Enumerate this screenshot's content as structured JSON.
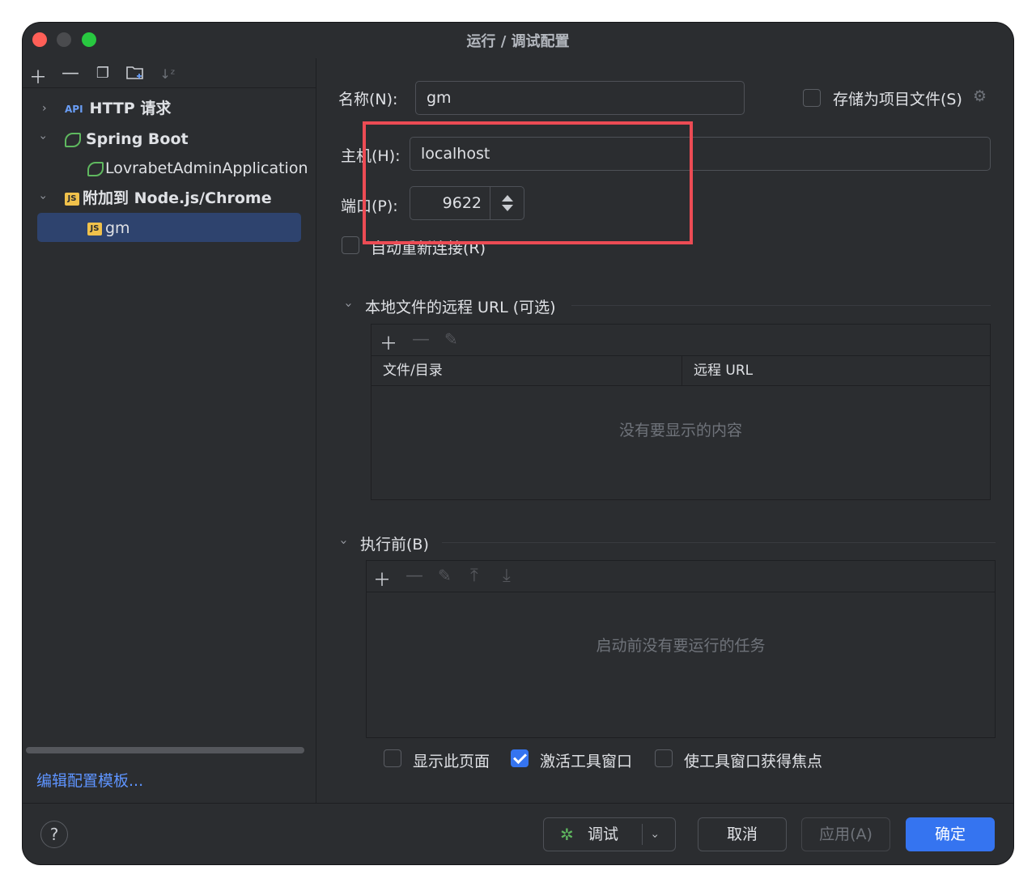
{
  "window": {
    "title": "运行 / 调试配置"
  },
  "left": {
    "toolbar": [
      "add-icon",
      "remove-icon",
      "copy-icon",
      "folder-add-icon",
      "sort-icon"
    ],
    "tree": [
      {
        "label": "HTTP 请求",
        "icon": "api-icon",
        "expanded": false
      },
      {
        "label": "Spring Boot",
        "icon": "spring-boot-icon",
        "expanded": true
      },
      {
        "label": "LovrabetAdminApplication",
        "icon": "spring-boot-icon"
      },
      {
        "label": "附加到 Node.js/Chrome",
        "icon": "nodejs-icon",
        "expanded": true
      },
      {
        "label": "gm",
        "icon": "nodejs-icon",
        "selected": true
      }
    ],
    "edit_templates": "编辑配置模板..."
  },
  "form": {
    "name_label": "名称(N):",
    "name_value": "gm",
    "store_label": "存储为项目文件(S)",
    "host_label": "主机(H):",
    "host_value": "localhost",
    "port_label": "端口(P):",
    "port_value": "9622",
    "reconnect_label": "自动重新连接(R)"
  },
  "remote_url": {
    "title": "本地文件的远程 URL (可选)",
    "col_file": "文件/目录",
    "col_url": "远程 URL",
    "empty": "没有要显示的内容"
  },
  "before": {
    "title": "执行前(B)",
    "empty": "启动前没有要运行的任务"
  },
  "options": {
    "show_page": "显示此页面",
    "activate_tool": "激活工具窗口",
    "focus_tool": "使工具窗口获得焦点",
    "activate_checked": true
  },
  "footer": {
    "help": "?",
    "debug": "调试",
    "cancel": "取消",
    "apply": "应用(A)",
    "ok": "确定"
  },
  "colors": {
    "accent": "#3574f0",
    "highlight_box": "#ec4b54",
    "link": "#5e94ff"
  }
}
